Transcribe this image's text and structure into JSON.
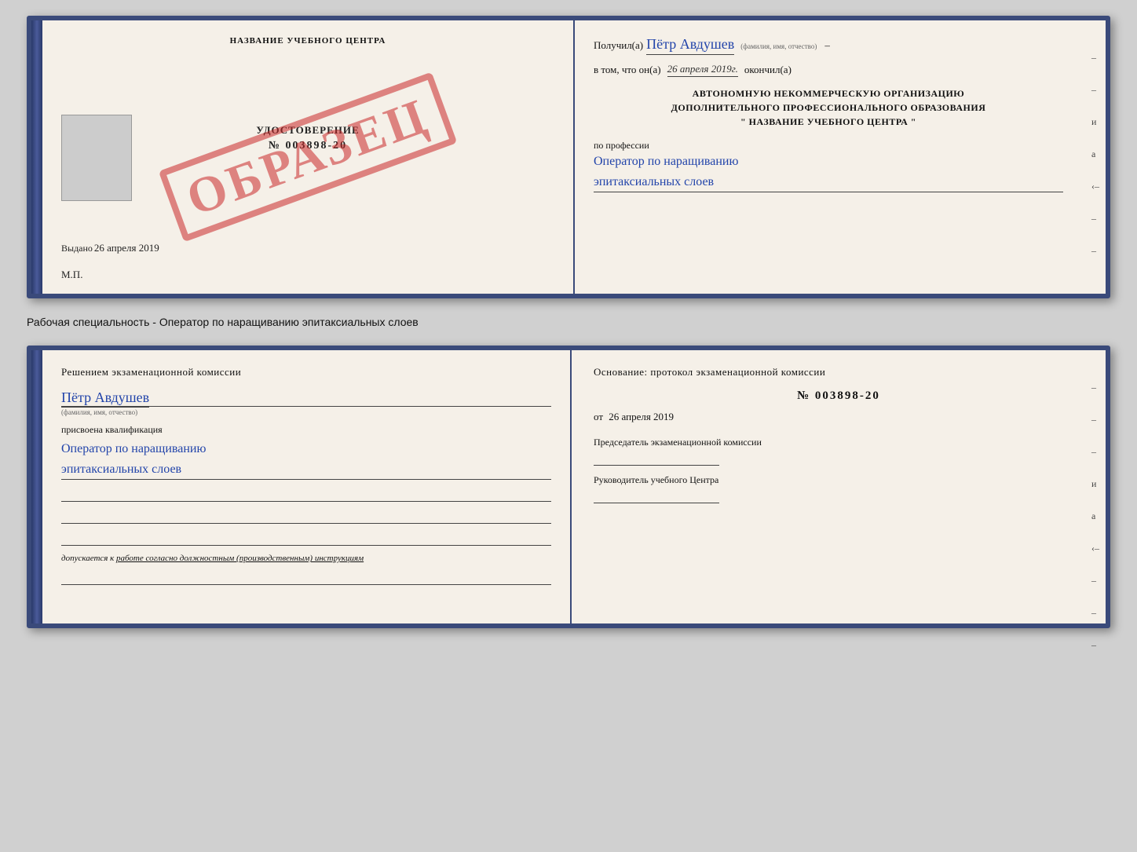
{
  "page": {
    "background_color": "#d0d0d0"
  },
  "top_certificate": {
    "left": {
      "title": "НАЗВАНИЕ УЧЕБНОГО ЦЕНТРА",
      "stamp": "ОБРАЗЕЦ",
      "cert_label": "УДОСТОВЕРЕНИЕ",
      "cert_number": "№ 003898-20",
      "issued_label": "Выдано",
      "issued_date": "26 апреля 2019",
      "mp_label": "М.П."
    },
    "right": {
      "received_prefix": "Получил(а)",
      "recipient_name": "Пётр Авдушев",
      "name_label": "(фамилия, имя, отчество)",
      "separator": "–",
      "date_prefix": "в том, что он(а)",
      "completion_date": "26 апреля 2019г.",
      "completed_label": "окончил(а)",
      "org_line1": "АВТОНОМНУЮ НЕКОММЕРЧЕСКУЮ ОРГАНИЗАЦИЮ",
      "org_line2": "ДОПОЛНИТЕЛЬНОГО ПРОФЕССИОНАЛЬНОГО ОБРАЗОВАНИЯ",
      "org_line3": "\" НАЗВАНИЕ УЧЕБНОГО ЦЕНТРА \"",
      "profession_prefix": "по профессии",
      "profession": "Оператор по наращиванию эпитаксиальных слоев",
      "side_marks": [
        "–",
        "–",
        "и",
        "а",
        "‹–",
        "–",
        "–"
      ]
    }
  },
  "separator_text": "Рабочая специальность - Оператор по наращиванию эпитаксиальных слоев",
  "bottom_certificate": {
    "left": {
      "decision_text": "Решением экзаменационной комиссии",
      "name": "Пётр Авдушев",
      "name_label": "(фамилия, имя, отчество)",
      "qualification_label": "присвоена квалификация",
      "qualification": "Оператор по наращиванию эпитаксиальных слоев",
      "допуск_prefix": "допускается к",
      "допуск_text": "работе согласно должностным (производственным) инструкциям"
    },
    "right": {
      "osnование_text": "Основание: протокол экзаменационной комиссии",
      "protocol_number": "№ 003898-20",
      "from_prefix": "от",
      "from_date": "26 апреля 2019",
      "chairman_label": "Председатель экзаменационной комиссии",
      "director_label": "Руководитель учебного Центра",
      "side_marks": [
        "–",
        "–",
        "–",
        "и",
        "а",
        "‹–",
        "–",
        "–",
        "–"
      ]
    }
  }
}
